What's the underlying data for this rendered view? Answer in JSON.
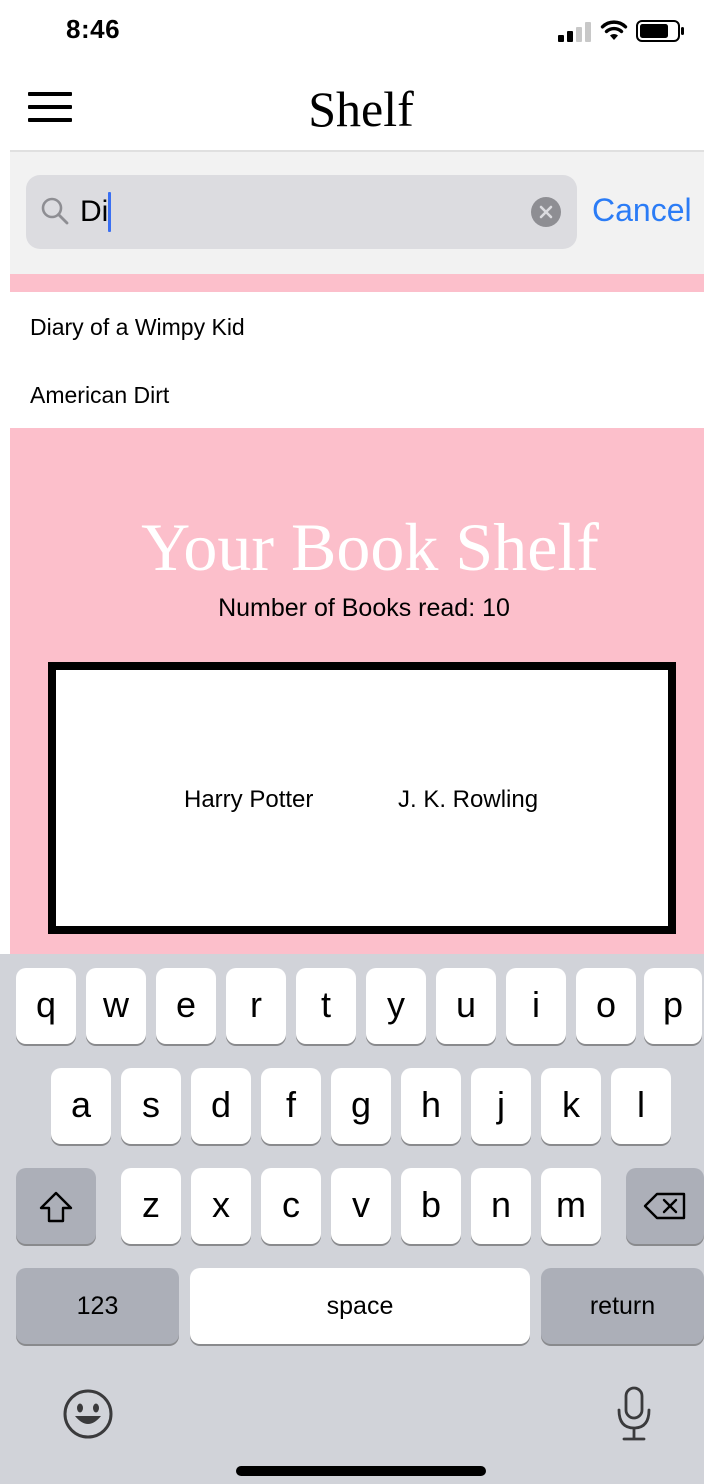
{
  "status_bar": {
    "time": "8:46"
  },
  "header": {
    "title": "Shelf"
  },
  "search": {
    "value": "Di",
    "cancel_label": "Cancel"
  },
  "results": [
    {
      "label": "Diary of a Wimpy Kid"
    },
    {
      "label": "American Dirt"
    }
  ],
  "shelf": {
    "title": "Your Book Shelf",
    "count_text": "Number of Books read: 10",
    "book": {
      "title": "Harry Potter",
      "author": "J. K. Rowling"
    }
  },
  "keyboard": {
    "row1": [
      "q",
      "w",
      "e",
      "r",
      "t",
      "y",
      "u",
      "i",
      "o",
      "p"
    ],
    "row2": [
      "a",
      "s",
      "d",
      "f",
      "g",
      "h",
      "j",
      "k",
      "l"
    ],
    "row3": [
      "z",
      "x",
      "c",
      "v",
      "b",
      "n",
      "m"
    ],
    "numbers_label": "123",
    "space_label": "space",
    "return_label": "return",
    "icons": {
      "shift": "shift-icon",
      "delete": "delete-icon",
      "emoji": "emoji-icon",
      "mic": "microphone-icon"
    }
  },
  "colors": {
    "accent_pink": "#fcbfcb",
    "link_blue": "#2b7cf6"
  }
}
